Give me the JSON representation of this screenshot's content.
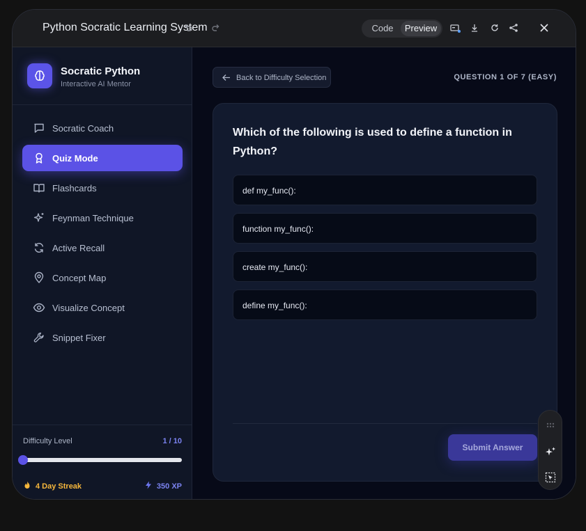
{
  "topbar": {
    "title": "Python Socratic Learning System",
    "view_options": [
      "Code",
      "Preview"
    ],
    "active_view": "Preview",
    "icons": [
      "undo-icon",
      "redo-icon",
      "device-preview-icon",
      "download-icon",
      "refresh-icon",
      "share-icon",
      "close-icon"
    ]
  },
  "sidebar": {
    "brand": {
      "name": "Socratic Python",
      "subtitle": "Interactive AI Mentor",
      "icon": "brain-icon"
    },
    "items": [
      {
        "label": "Socratic Coach",
        "icon": "chat-bubble-icon",
        "active": false
      },
      {
        "label": "Quiz Mode",
        "icon": "award-icon",
        "active": true
      },
      {
        "label": "Flashcards",
        "icon": "open-book-icon",
        "active": false
      },
      {
        "label": "Feynman Technique",
        "icon": "sparkles-icon",
        "active": false
      },
      {
        "label": "Active Recall",
        "icon": "refresh-cycle-icon",
        "active": false
      },
      {
        "label": "Concept Map",
        "icon": "map-pin-icon",
        "active": false
      },
      {
        "label": "Visualize Concept",
        "icon": "eye-icon",
        "active": false
      },
      {
        "label": "Snippet Fixer",
        "icon": "wrench-icon",
        "active": false
      }
    ],
    "difficulty": {
      "label": "Difficulty Level",
      "value_text": "1 / 10",
      "level": 1,
      "max": 10
    },
    "streak": "4 Day Streak",
    "xp": "350 XP"
  },
  "main": {
    "back_label": "Back to Difficulty Selection",
    "question_counter": "QUESTION 1 OF 7 (EASY)",
    "question": "Which of the following is used to define a function in Python?",
    "options": [
      "def my_func():",
      "function my_func():",
      "create my_func():",
      "define my_func():"
    ],
    "submit_label": "Submit Answer"
  },
  "palette": {
    "icons": [
      "drag-handle-icon",
      "magic-sparkle-icon",
      "select-element-icon"
    ]
  },
  "colors": {
    "accent": "#5b52e6",
    "streak": "#f6b73c",
    "xp": "#7b83f0",
    "background": "#070a18"
  }
}
